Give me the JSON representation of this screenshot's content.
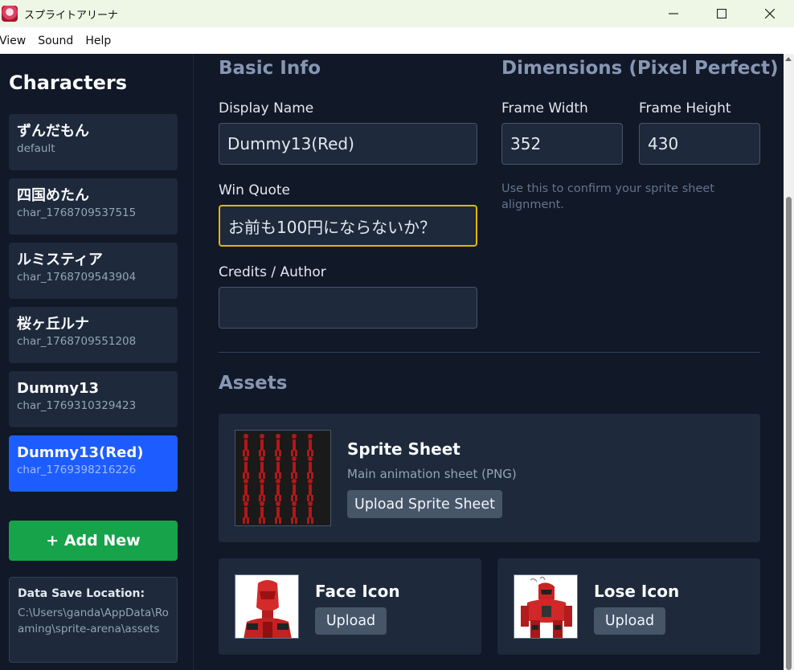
{
  "window": {
    "title": "スプライトアリーナ",
    "minimize_icon": "minimize-icon",
    "maximize_icon": "maximize-icon",
    "close_icon": "close-icon"
  },
  "menu": [
    "View",
    "Sound",
    "Help"
  ],
  "sidebar": {
    "heading": "Characters",
    "characters": [
      {
        "name": "ずんだもん",
        "id": "default",
        "active": false
      },
      {
        "name": "四国めたん",
        "id": "char_1768709537515",
        "active": false
      },
      {
        "name": "ルミスティア",
        "id": "char_1768709543904",
        "active": false
      },
      {
        "name": "桜ヶ丘ルナ",
        "id": "char_1768709551208",
        "active": false
      },
      {
        "name": "Dummy13",
        "id": "char_1769310329423",
        "active": false
      },
      {
        "name": "Dummy13(Red)",
        "id": "char_1769398216226",
        "active": true
      }
    ],
    "add_button": "+ Add New",
    "save_location_label": "Data Save Location:",
    "save_location_path": "C:\\Users\\ganda\\AppData\\Roaming\\sprite-arena\\assets"
  },
  "basic_info": {
    "title": "Basic Info",
    "display_name_label": "Display Name",
    "display_name_value": "Dummy13(Red)",
    "win_quote_label": "Win Quote",
    "win_quote_value": "お前も100円にならないか？",
    "credits_label": "Credits / Author",
    "credits_value": ""
  },
  "dimensions": {
    "title": "Dimensions (Pixel Perfect)",
    "frame_width_label": "Frame Width",
    "frame_width_value": "352",
    "frame_height_label": "Frame Height",
    "frame_height_value": "430",
    "hint": "Use this to confirm your sprite sheet alignment."
  },
  "assets": {
    "title": "Assets",
    "sprite_sheet": {
      "title": "Sprite Sheet",
      "subtitle": "Main animation sheet (PNG)",
      "button": "Upload Sprite Sheet"
    },
    "face_icon": {
      "title": "Face Icon",
      "button": "Upload"
    },
    "lose_icon": {
      "title": "Lose Icon",
      "button": "Upload"
    }
  },
  "colors": {
    "accent_active": "#1d5cff",
    "add_button": "#16a34a",
    "focus_border": "#eab308",
    "background": "#111827"
  }
}
